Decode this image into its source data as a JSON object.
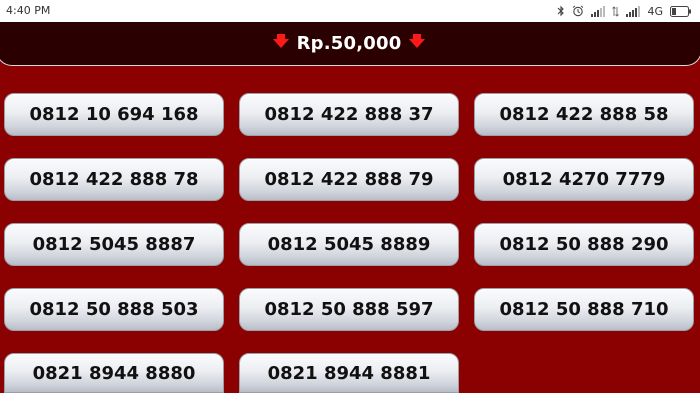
{
  "status_bar": {
    "time": "4:40 PM",
    "network_label": "4G",
    "icons": [
      "bluetooth-icon",
      "alarm-icon",
      "signal-icon",
      "signal-icon",
      "battery-icon"
    ]
  },
  "header": {
    "price_label": "Rp.50,000",
    "arrow_color": "#ff1a1a"
  },
  "colors": {
    "page_background": "#8b0000",
    "header_background": "#2a0000",
    "button_text": "#111111"
  },
  "numbers": [
    "0812 10 694 168",
    "0812 422 888 37",
    "0812 422 888 58",
    "0812 422 888 78",
    "0812 422 888 79",
    "0812 4270 7779",
    "0812 5045 8887",
    "0812 5045 8889",
    "0812 50 888 290",
    "0812 50 888 503",
    "0812 50 888 597",
    "0812 50 888 710",
    "0821 8944 8880",
    "0821 8944 8881"
  ]
}
